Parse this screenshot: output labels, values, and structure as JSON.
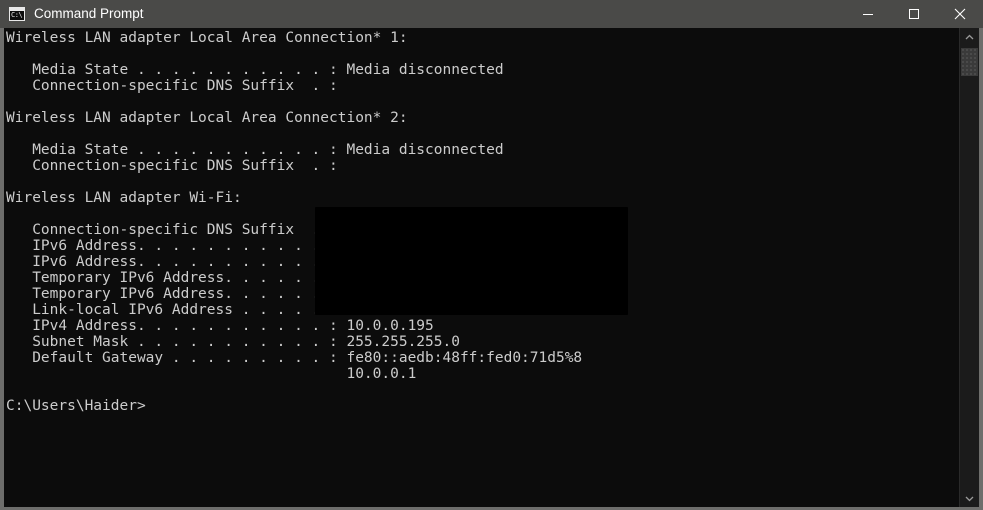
{
  "window": {
    "title": "Command Prompt",
    "icon": "cmd-icon",
    "icon_glyph": "C:\\",
    "colors": {
      "titlebar": "#4a4a48",
      "console_bg": "#0c0c0c",
      "console_text": "#cccccc",
      "frame": "#6e6e6c",
      "redaction": "#000000"
    },
    "controls": {
      "minimize": "Minimize",
      "maximize": "Maximize",
      "close": "Close"
    }
  },
  "console": {
    "prompt": "C:\\Users\\Haider>",
    "text": "Wireless LAN adapter Local Area Connection* 1:\n\n   Media State . . . . . . . . . . . : Media disconnected\n   Connection-specific DNS Suffix  . :\n\nWireless LAN adapter Local Area Connection* 2:\n\n   Media State . . . . . . . . . . . : Media disconnected\n   Connection-specific DNS Suffix  . :\n\nWireless LAN adapter Wi-Fi:\n\n   Connection-specific DNS Suffix  . :\n   IPv6 Address. . . . . . . . . . . :\n   IPv6 Address. . . . . . . . . . . :\n   Temporary IPv6 Address. . . . . . :\n   Temporary IPv6 Address. . . . . . :\n   Link-local IPv6 Address . . . . . :\n   IPv4 Address. . . . . . . . . . . : 10.0.0.195\n   Subnet Mask . . . . . . . . . . . : 255.255.255.0\n   Default Gateway . . . . . . . . . : fe80::aedb:48ff:fed0:71d5%8\n                                       10.0.0.1\n\nC:\\Users\\Haider>",
    "sections": [
      {
        "header": "Wireless LAN adapter Local Area Connection* 1:",
        "rows": [
          {
            "label": "Media State . . . . . . . . . . . :",
            "value": "Media disconnected"
          },
          {
            "label": "Connection-specific DNS Suffix  . :",
            "value": ""
          }
        ]
      },
      {
        "header": "Wireless LAN adapter Local Area Connection* 2:",
        "rows": [
          {
            "label": "Media State . . . . . . . . . . . :",
            "value": "Media disconnected"
          },
          {
            "label": "Connection-specific DNS Suffix  . :",
            "value": ""
          }
        ]
      },
      {
        "header": "Wireless LAN adapter Wi-Fi:",
        "rows": [
          {
            "label": "Connection-specific DNS Suffix  . :",
            "value": "",
            "redacted": true
          },
          {
            "label": "IPv6 Address. . . . . . . . . . . :",
            "value": "",
            "redacted": true
          },
          {
            "label": "IPv6 Address. . . . . . . . . . . :",
            "value": "",
            "redacted": true
          },
          {
            "label": "Temporary IPv6 Address. . . . . . :",
            "value": "",
            "redacted": true
          },
          {
            "label": "Temporary IPv6 Address. . . . . . :",
            "value": "",
            "redacted": true
          },
          {
            "label": "Link-local IPv6 Address . . . . . :",
            "value": "",
            "redacted": true
          },
          {
            "label": "IPv4 Address. . . . . . . . . . . :",
            "value": "10.0.0.195",
            "redacted": false
          },
          {
            "label": "Subnet Mask . . . . . . . . . . . :",
            "value": "255.255.255.0",
            "redacted": false
          },
          {
            "label": "Default Gateway . . . . . . . . . :",
            "value": "fe80::aedb:48ff:fed0:71d5%8",
            "redacted": false
          },
          {
            "label": "",
            "value": "10.0.0.1",
            "redacted": false
          }
        ]
      }
    ]
  },
  "scrollbar": {
    "up_arrow": "scroll-up-icon",
    "down_arrow": "scroll-down-icon",
    "thumb_position_percent": 2
  }
}
